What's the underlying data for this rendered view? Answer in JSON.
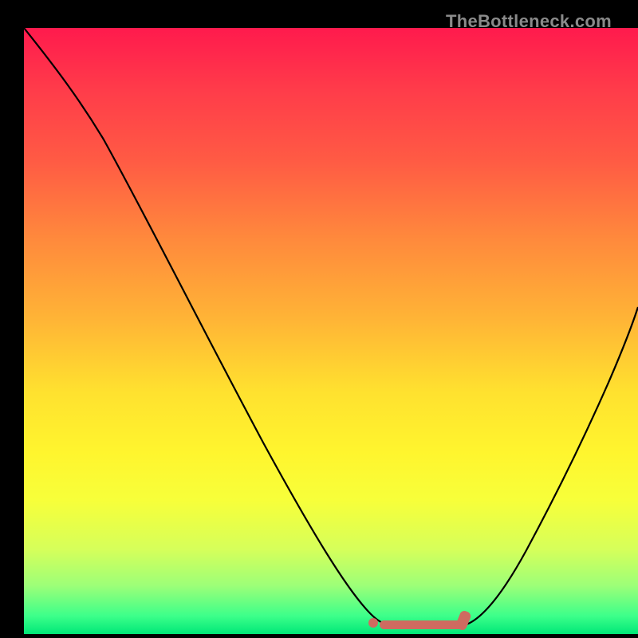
{
  "attribution": "TheBottleneck.com",
  "colors": {
    "gradient_top": "#ff1a4d",
    "gradient_bottom": "#00e878",
    "curve": "#000000",
    "marker": "#cf6b60",
    "background": "#000000"
  },
  "chart_data": {
    "type": "line",
    "title": "",
    "xlabel": "",
    "ylabel": "",
    "xlim": [
      0,
      100
    ],
    "ylim": [
      0,
      100
    ],
    "grid": false,
    "legend": false,
    "description": "Bottleneck curve: high bottleneck (red) at both extremes, dropping to near-zero (green) around x≈60–70.",
    "series": [
      {
        "name": "bottleneck",
        "x": [
          0,
          5,
          10,
          15,
          20,
          25,
          30,
          35,
          40,
          45,
          50,
          55,
          58,
          60,
          63,
          66,
          70,
          74,
          78,
          82,
          86,
          90,
          95,
          100
        ],
        "values": [
          100,
          95,
          88,
          80,
          71,
          62,
          53,
          44,
          35,
          26,
          17,
          8,
          2,
          1,
          1,
          1,
          1,
          3,
          9,
          17,
          26,
          36,
          50,
          65
        ]
      }
    ],
    "highlight_range_x": [
      58,
      72
    ],
    "highlight_dot_x": 56
  }
}
